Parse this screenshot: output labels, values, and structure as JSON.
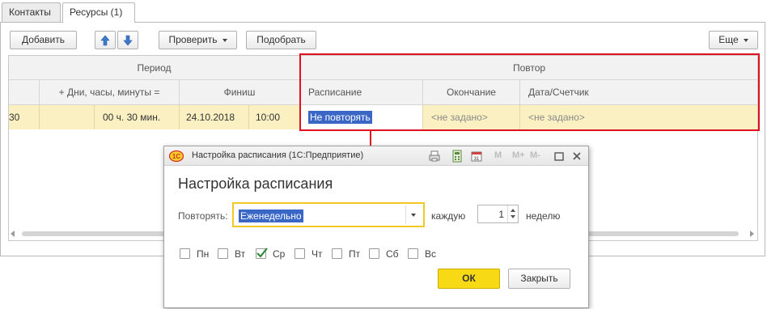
{
  "tabs": [
    {
      "label": "Контакты"
    },
    {
      "label": "Ресурсы (1)"
    }
  ],
  "toolbar": {
    "add_label": "Добавить",
    "check_label": "Проверить",
    "pick_label": "Подобрать",
    "more_label": "Еще"
  },
  "table": {
    "group_period": "Период",
    "group_repeat": "Повтор",
    "col_duration": "+ Дни, часы, минуты =",
    "col_finish": "Финиш",
    "col_schedule": "Расписание",
    "col_end": "Окончание",
    "col_date_counter": "Дата/Счетчик",
    "row": {
      "start_time_partial": "30",
      "duration": "00 ч. 30 мин.",
      "finish_date": "24.10.2018",
      "finish_time": "10:00",
      "schedule": "Не повторять",
      "end": "<не задано>",
      "date_counter": "<не задано>"
    }
  },
  "dialog": {
    "window_title": "Настройка расписания  (1С:Предприятие)",
    "heading": "Настройка расписания",
    "repeat_label": "Повторять:",
    "repeat_value": "Еженедельно",
    "every_label": "каждую",
    "interval_value": "1",
    "unit_label": "неделю",
    "days": [
      {
        "label": "Пн",
        "checked": false
      },
      {
        "label": "Вт",
        "checked": false
      },
      {
        "label": "Ср",
        "checked": true
      },
      {
        "label": "Чт",
        "checked": false
      },
      {
        "label": "Пт",
        "checked": false
      },
      {
        "label": "Сб",
        "checked": false
      },
      {
        "label": "Вс",
        "checked": false
      }
    ],
    "ok_label": "ОК",
    "close_label": "Закрыть",
    "mem_buttons": [
      "M",
      "M+",
      "M-"
    ]
  },
  "colors": {
    "selected_row": "#fbf0c2",
    "highlight_box": "#e0101e",
    "ok_button": "#f7d916",
    "selection": "#3a66c6"
  }
}
